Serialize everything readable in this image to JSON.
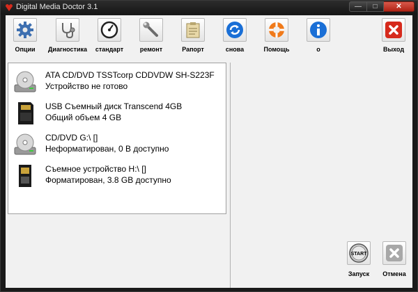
{
  "window": {
    "title": "Digital Media Doctor 3.1",
    "buttons": {
      "minimize": "—",
      "maximize": "□",
      "close": "✕"
    }
  },
  "toolbar": {
    "items": [
      {
        "label": "Опции",
        "icon": "gear-icon"
      },
      {
        "label": "Диагностика",
        "icon": "stethoscope-icon"
      },
      {
        "label": "стандарт",
        "icon": "gauge-icon"
      },
      {
        "label": "ремонт",
        "icon": "wrench-icon"
      },
      {
        "label": "Рапорт",
        "icon": "clipboard-icon"
      },
      {
        "label": "снова",
        "icon": "refresh-icon"
      },
      {
        "label": "Помощь",
        "icon": "lifebuoy-icon"
      },
      {
        "label": "о",
        "icon": "info-icon"
      },
      {
        "label": "Выход",
        "icon": "exit-icon"
      }
    ]
  },
  "drives": [
    {
      "name": "ATA CD/DVD TSSTcorp CDDVDW SH-S223F",
      "status": "Устройство не готово",
      "icon": "optical-drive-icon"
    },
    {
      "name": "USB Съемный диск Transcend 4GB",
      "status": "Общий объем 4 GB",
      "icon": "sd-card-icon"
    },
    {
      "name": "CD/DVD G:\\ []",
      "status": "Неформатирован, 0 B доступно",
      "icon": "optical-drive-icon"
    },
    {
      "name": "Съемное устройство H:\\ []",
      "status": "Форматирован, 3.8 GB доступно",
      "icon": "memory-card-icon"
    }
  ],
  "actions": {
    "start": {
      "label": "Запуск",
      "icon_text": "START"
    },
    "cancel": {
      "label": "Отмена"
    }
  },
  "colors": {
    "accent_red": "#d62a1c",
    "accent_blue": "#1a6fd6",
    "window_bg": "#f1f1f1"
  }
}
